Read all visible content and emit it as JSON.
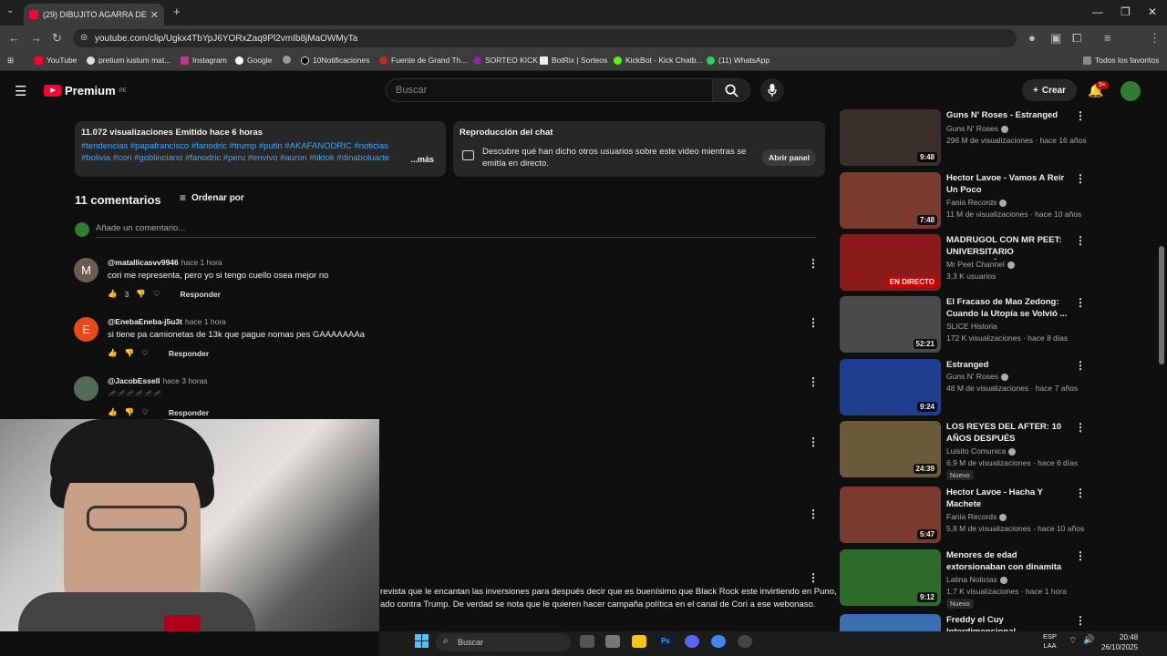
{
  "browser": {
    "tab_title": "(29) DIBUJITO AGARRA DE W3B",
    "tab_close": "✕",
    "new_tab": "+",
    "url": "youtube.com/clip/Ugkx4TbYpJ6YORxZaq9Pl2vmIb8jMaOWMyTa",
    "bookmarks": [
      "YouTube",
      "pretium iustum mat...",
      "Instagram",
      "Google",
      "10Notificaciones",
      "Fuente de Grand Th...",
      "SORTEO KICK",
      "BotRix | Sorteos",
      "KickBot - Kick Chatb...",
      "(11) WhatsApp"
    ],
    "all_bookmarks": "Todos los favoritos"
  },
  "yt": {
    "logo": "Premium",
    "logo_region": "PE",
    "search_placeholder": "Buscar",
    "create_label": "Crear",
    "notif_badge": "9+"
  },
  "description": {
    "stats": "11.072 visualizaciones  Emitido hace 6 horas",
    "tags": "#tendencias #papafrancisco #fanodric #trump #putin  #AKAFANODRIC #noticias #bolivia #cori #goblinciano #fanodric #peru #envivo #auron #tiktok #dinaboluarte #latinanotic",
    "more": "...más"
  },
  "chat": {
    "title": "Reproducción del chat",
    "desc": "Descubre qué han dicho otros usuarios sobre este video mientras se emitía en directo.",
    "button": "Abrir panel"
  },
  "comments_header": {
    "count": "11 comentarios",
    "sort": "Ordenar por",
    "add_placeholder": "Añade un comentario..."
  },
  "comments": [
    {
      "initial": "M",
      "color": "#6d5c54",
      "author": "@matallicasvv9946",
      "time": "hace 1 hora",
      "text": "cori me representa, pero yo si tengo cuello osea mejor no",
      "likes": "3",
      "reply": "Responder"
    },
    {
      "initial": "E",
      "color": "#e64a19",
      "author": "@EnebaEneba-j5u3t",
      "time": "hace 1 hora",
      "text": "si tiene pa camionetas de 13k que pague nomas pes GAAAAAAAa",
      "likes": "",
      "reply": "Responder"
    },
    {
      "initial": "",
      "color": "#556b5a",
      "author": "@JacobEssell",
      "time": "hace 3 horas",
      "text": "🦟🦟🦟🦟🦟🦟",
      "likes": "",
      "reply": "Responder"
    }
  ],
  "partial_comment": {
    "line1": "revista que le encantan las inversiones para después decir que es buenísimo que Black Rock este invirtiendo en Puno,",
    "line2": "ado contra Trump. De verdad se nota que le quieren hacer campaña política en el canal de Cori a ese webonaso."
  },
  "sidebar": [
    {
      "title": "Guns N' Roses - Estranged",
      "channel": "Guns N' Roses",
      "meta": "296 M de visualizaciones · hace 16 años",
      "duration": "9:48",
      "badge": "",
      "thumb": "#3a2f2a"
    },
    {
      "title": "Hector Lavoe - Vamos A Reir Un Poco",
      "channel": "Fania Records",
      "meta": "11 M de visualizaciones · hace 10 años",
      "duration": "7:48",
      "badge": "",
      "thumb": "#7a3b2e"
    },
    {
      "title": "MADRUGOL CON MR PEET: UNIVERSITARIO TRICAMPEÓ...",
      "channel": "Mr Peet Channel",
      "meta": "3,3 K usuarios",
      "duration": "EN DIRECTO",
      "badge": "",
      "thumb": "#8b1a1a"
    },
    {
      "title": "El Fracaso de Mao Zedong: Cuando la Utopía se Volvió ...",
      "channel": "SLICE Historia",
      "meta": "172 K visualizaciones · hace 8 días",
      "duration": "52:21",
      "badge": "",
      "thumb": "#4a4a4a"
    },
    {
      "title": "Estranged",
      "channel": "Guns N' Roses",
      "meta": "48 M de visualizaciones · hace 7 años",
      "duration": "9:24",
      "badge": "",
      "thumb": "#1e3f8f"
    },
    {
      "title": "LOS REYES DEL AFTER: 10 AÑOS DESPUÉS",
      "channel": "Luisito Comunica",
      "meta": "6,9 M de visualizaciones · hace 6 días",
      "duration": "24:39",
      "badge": "Nuevo",
      "thumb": "#6b5a3a"
    },
    {
      "title": "Hector Lavoe - Hacha Y Machete",
      "channel": "Fania Records",
      "meta": "5,8 M de visualizaciones · hace 10 años",
      "duration": "5:47",
      "badge": "",
      "thumb": "#7a3b2e"
    },
    {
      "title": "Menores de edad extorsionaban con dinamita en Lima",
      "channel": "Latina Noticias",
      "meta": "1,7 K visualizaciones · hace 1 hora",
      "duration": "9:12",
      "badge": "Nuevo",
      "thumb": "#2d6b2a"
    },
    {
      "title": "Freddy el Cuy Interdimensional",
      "channel": "",
      "meta": "",
      "duration": "",
      "badge": "",
      "thumb": "#3b6fb0"
    }
  ],
  "taskbar": {
    "search": "Buscar",
    "lang_top": "ESP",
    "lang_bottom": "LAA",
    "time": "20:48",
    "date": "26/10/2025"
  }
}
